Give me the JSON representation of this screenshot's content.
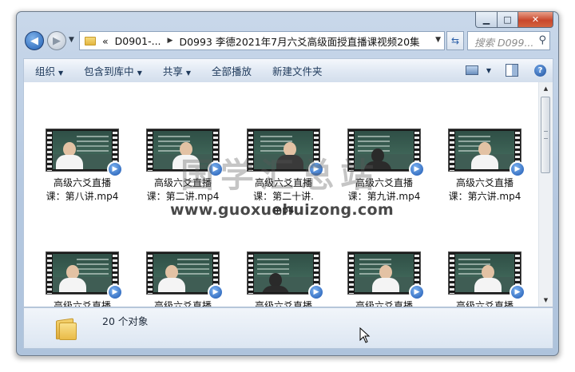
{
  "window": {
    "controls": {
      "minimize": "▁",
      "maximize": "□",
      "close": "✕"
    }
  },
  "nav": {
    "back_icon": "arrow-left-icon",
    "forward_icon": "arrow-right-icon",
    "breadcrumbs": [
      "«",
      "D0901-...",
      "D0993 李德2021年7月六爻高级面授直播课视频20集"
    ],
    "search_placeholder": "搜索 D099...",
    "refresh_icon": "refresh-icon"
  },
  "toolbar": {
    "items": [
      "组织",
      "包含到库中",
      "共享",
      "全部播放",
      "新建文件夹"
    ]
  },
  "files": {
    "row1": [
      {
        "name": "高级六爻直播课：第八讲.mp4",
        "line1": "高级六爻直播",
        "line2": "课：第八讲.mp4"
      },
      {
        "name": "高级六爻直播课：第二讲.mp4",
        "line1": "高级六爻直播",
        "line2": "课：第二讲.mp4"
      },
      {
        "name": "高级六爻直播课：第二十讲.mp4",
        "line1": "高级六爻直播",
        "line2": "课：第二十讲.",
        "line3": "mp4"
      },
      {
        "name": "高级六爻直播课：第九讲.mp4",
        "line1": "高级六爻直播",
        "line2": "课：第九讲.mp4"
      },
      {
        "name": "高级六爻直播课：第六讲.mp4",
        "line1": "高级六爻直播",
        "line2": "课：第六讲.mp4"
      }
    ],
    "row2": [
      {
        "line1": "高级六爻直播"
      },
      {
        "line1": "高级六爻直播"
      },
      {
        "line1": "高级六爻直播"
      },
      {
        "line1": "高级六爻直播"
      },
      {
        "line1": "高级六爻直播"
      }
    ]
  },
  "status": {
    "count": "20 个对象"
  },
  "watermark": {
    "cn": "国学汇总站",
    "url": "www.guoxuehuizong.com"
  },
  "colors": {
    "accent": "#1c56b0",
    "titlebar": "#b6c9e1",
    "close": "#c9472c"
  }
}
